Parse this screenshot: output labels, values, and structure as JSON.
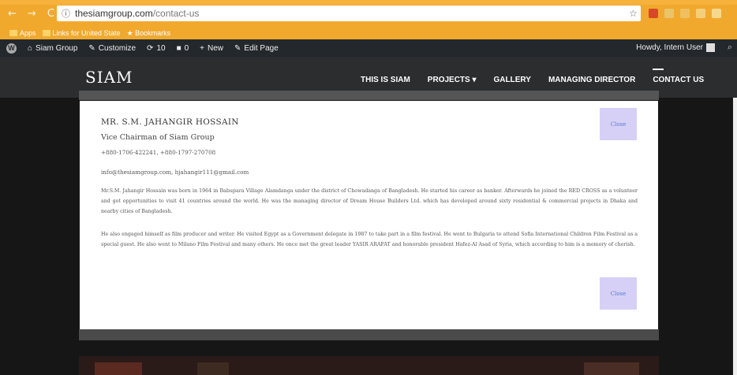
{
  "browser": {
    "url_host": "thesiamgroup.com",
    "url_path": "/contact-us",
    "bookmarks": [
      "Apps",
      "Links for United State",
      "Bookmarks"
    ]
  },
  "adminbar": {
    "site": "Siam Group",
    "customize": "Customize",
    "updates": "10",
    "comments": "0",
    "new": "New",
    "edit": "Edit Page",
    "howdy": "Howdy, Intern User"
  },
  "site": {
    "logo": "SIAM",
    "nav": [
      "THIS IS SIAM",
      "PROJECTS",
      "GALLERY",
      "MANAGING DIRECTOR",
      "CONTACT US"
    ]
  },
  "modal": {
    "name": "MR. S.M. JAHANGIR HOSSAIN",
    "role": "Vice Chairman of Siam Group",
    "phone": "+880-1706-422241, +880-1797-270708",
    "email": "info@thesiamgroup.com, hjahangir111@gmail.com",
    "para1": "Mr.S.M. Jahangir Hossain was born in 1964 in Babupara Village Alamdanga under the district of Chowadanga of Bangladesh. He started his career as banker. Afterwards he joined the RED CROSS as a volunteer and got opportunities to visit 41 countries around the world. He was the managing director of Dream House Builders Ltd. which has developed around sixty residential & commercial projects in Dhaka and nearby cities of Bangladesh.",
    "para2": "He also engaged himself as film producer and writer. He visited Egypt as a Government delegate in 1987 to take part in a film festival. He went to Bulgaria to attend Sofia International Children Film Festival as a special guest. He also went to Milano Film Festival and many others. He once met the great leader YASIR ARAFAT and honorable president Hafez-Al Asad of Syria, which according to him is a memory of cherish.",
    "close_label": "Close"
  },
  "colors": {
    "chrome": "#f1a92d",
    "adminbar": "#23282d",
    "close_button": "#d6d0f7"
  }
}
